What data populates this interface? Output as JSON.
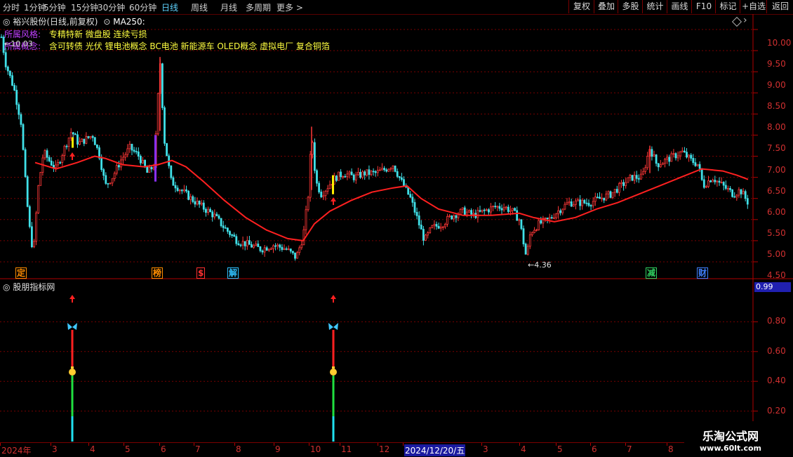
{
  "toolbar": {
    "timeframes": [
      "分时",
      "1分钟",
      "5分钟",
      "15分钟",
      "30分钟",
      "60分钟",
      "日线",
      "周线",
      "月线",
      "多周期",
      "更多 >"
    ],
    "active": "日线",
    "buttons": [
      "复权",
      "叠加",
      "多股",
      "统计",
      "画线",
      "F10",
      "标记",
      "+自选",
      "返回"
    ]
  },
  "stock": {
    "title": "裕兴股份(日线,前复权)",
    "ma_label": "MA250:",
    "style_label": "所属风格:",
    "style_value": "专精特新 微盘股 连续亏损",
    "concept_label": "所属概念:",
    "concept_value": "含可转债 光伏 锂电池概念 BC电池 新能源车 OLED概念 虚拟电厂 复合铜箔",
    "high_marker": "10.03",
    "low_marker": "4.36"
  },
  "indicator": {
    "title": "股朋指标网",
    "current_value": "0.99"
  },
  "price_axis": [
    "10.00",
    "9.50",
    "9.00",
    "8.50",
    "8.00",
    "7.50",
    "7.00",
    "6.50",
    "6.00",
    "5.50",
    "5.00",
    "4.50"
  ],
  "indicator_axis": [
    "0.80",
    "0.60",
    "0.40",
    "0.20"
  ],
  "events": [
    {
      "label": "定",
      "color": "#ff8c00"
    },
    {
      "label": "榜",
      "color": "#ff8c00"
    },
    {
      "label": "$",
      "color": "#ff3030"
    },
    {
      "label": "解",
      "color": "#30c0ff"
    },
    {
      "label": "减",
      "color": "#30d060"
    },
    {
      "label": "财",
      "color": "#4080ff"
    }
  ],
  "date_axis": [
    "2024年",
    "3",
    "4",
    "5",
    "6",
    "7",
    "8",
    "9",
    "10",
    "11",
    "12",
    "2024/12/20/五",
    "3",
    "4",
    "5",
    "6",
    "7",
    "8"
  ],
  "watermark": {
    "line1": "乐淘公式网",
    "line2": "www.60lt.com"
  },
  "chart_data": {
    "type": "candlestick",
    "y_range": [
      4.3,
      10.2
    ],
    "price_path": [
      [
        0,
        10.03
      ],
      [
        8,
        9.2
      ],
      [
        20,
        8.6
      ],
      [
        30,
        7.8
      ],
      [
        38,
        6.0
      ],
      [
        44,
        5.0
      ],
      [
        48,
        4.8
      ],
      [
        54,
        6.2
      ],
      [
        62,
        7.1
      ],
      [
        70,
        6.9
      ],
      [
        80,
        6.7
      ],
      [
        92,
        7.2
      ],
      [
        102,
        7.6
      ],
      [
        112,
        7.3
      ],
      [
        122,
        7.4
      ],
      [
        132,
        7.5
      ],
      [
        142,
        7.0
      ],
      [
        150,
        6.3
      ],
      [
        160,
        6.5
      ],
      [
        172,
        6.9
      ],
      [
        185,
        7.2
      ],
      [
        198,
        7.0
      ],
      [
        210,
        6.6
      ],
      [
        220,
        6.8
      ],
      [
        228,
        9.3
      ],
      [
        234,
        7.4
      ],
      [
        244,
        6.4
      ],
      [
        258,
        6.2
      ],
      [
        272,
        6.0
      ],
      [
        288,
        5.8
      ],
      [
        305,
        5.6
      ],
      [
        320,
        5.3
      ],
      [
        338,
        5.0
      ],
      [
        355,
        4.9
      ],
      [
        372,
        4.8
      ],
      [
        390,
        4.9
      ],
      [
        408,
        4.8
      ],
      [
        422,
        4.6
      ],
      [
        432,
        5.1
      ],
      [
        440,
        6.2
      ],
      [
        444,
        7.6
      ],
      [
        450,
        6.4
      ],
      [
        458,
        6.1
      ],
      [
        468,
        6.3
      ],
      [
        478,
        6.5
      ],
      [
        490,
        6.6
      ],
      [
        505,
        6.5
      ],
      [
        520,
        6.6
      ],
      [
        535,
        6.6
      ],
      [
        550,
        6.7
      ],
      [
        560,
        6.8
      ],
      [
        572,
        6.4
      ],
      [
        585,
        6.0
      ],
      [
        595,
        5.5
      ],
      [
        605,
        5.0
      ],
      [
        615,
        5.3
      ],
      [
        630,
        5.4
      ],
      [
        645,
        5.6
      ],
      [
        660,
        5.7
      ],
      [
        675,
        5.6
      ],
      [
        690,
        5.7
      ],
      [
        705,
        5.8
      ],
      [
        718,
        5.8
      ],
      [
        730,
        5.7
      ],
      [
        740,
        5.5
      ],
      [
        750,
        4.6
      ],
      [
        756,
        5.2
      ],
      [
        768,
        5.4
      ],
      [
        782,
        5.5
      ],
      [
        795,
        5.7
      ],
      [
        810,
        5.9
      ],
      [
        825,
        5.9
      ],
      [
        840,
        5.9
      ],
      [
        855,
        6.0
      ],
      [
        870,
        6.1
      ],
      [
        885,
        6.3
      ],
      [
        900,
        6.5
      ],
      [
        915,
        6.5
      ],
      [
        926,
        7.2
      ],
      [
        936,
        6.8
      ],
      [
        948,
        6.9
      ],
      [
        960,
        7.0
      ],
      [
        972,
        7.1
      ],
      [
        985,
        6.9
      ],
      [
        995,
        6.8
      ],
      [
        1002,
        6.3
      ],
      [
        1015,
        6.5
      ],
      [
        1030,
        6.3
      ],
      [
        1045,
        6.1
      ],
      [
        1055,
        6.2
      ],
      [
        1066,
        5.9
      ]
    ],
    "ma_path": [
      [
        50,
        6.85
      ],
      [
        80,
        6.7
      ],
      [
        110,
        6.85
      ],
      [
        135,
        7.0
      ],
      [
        150,
        6.95
      ],
      [
        175,
        6.8
      ],
      [
        205,
        6.75
      ],
      [
        225,
        6.8
      ],
      [
        245,
        6.9
      ],
      [
        265,
        6.75
      ],
      [
        290,
        6.4
      ],
      [
        320,
        5.95
      ],
      [
        350,
        5.55
      ],
      [
        380,
        5.25
      ],
      [
        410,
        5.05
      ],
      [
        432,
        5.0
      ],
      [
        448,
        5.4
      ],
      [
        470,
        5.7
      ],
      [
        500,
        5.95
      ],
      [
        530,
        6.15
      ],
      [
        560,
        6.25
      ],
      [
        580,
        6.3
      ],
      [
        600,
        6.0
      ],
      [
        625,
        5.75
      ],
      [
        660,
        5.6
      ],
      [
        700,
        5.6
      ],
      [
        740,
        5.65
      ],
      [
        760,
        5.55
      ],
      [
        790,
        5.45
      ],
      [
        820,
        5.55
      ],
      [
        850,
        5.75
      ],
      [
        880,
        5.9
      ],
      [
        910,
        6.1
      ],
      [
        940,
        6.3
      ],
      [
        970,
        6.5
      ],
      [
        1000,
        6.7
      ],
      [
        1030,
        6.65
      ],
      [
        1050,
        6.55
      ],
      [
        1066,
        6.45
      ]
    ],
    "signals": [
      {
        "x": 103,
        "type": "buy"
      },
      {
        "x": 475,
        "type": "buy"
      }
    ]
  }
}
